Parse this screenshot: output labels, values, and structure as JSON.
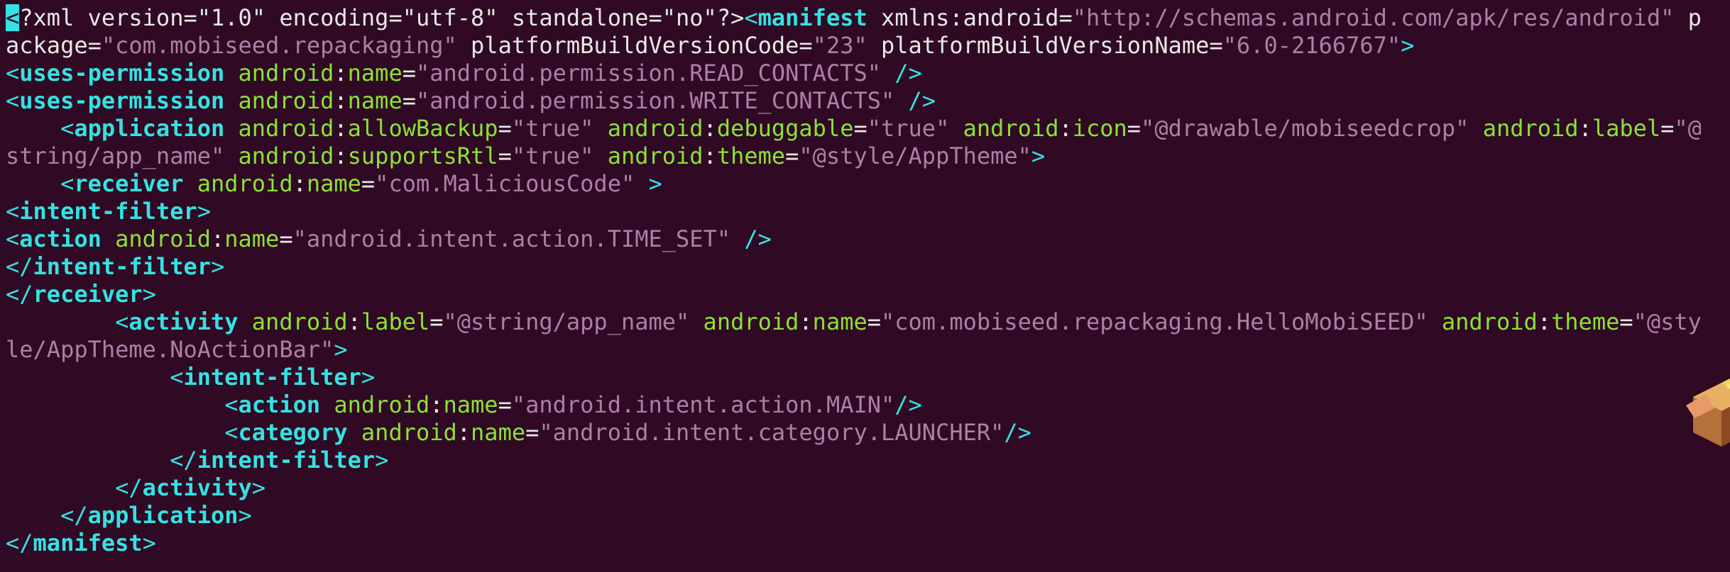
{
  "terminal": {
    "lines": [
      [
        {
          "t": "<",
          "c": "cursor"
        },
        {
          "t": "?xml version=\"1.0\" encoding=\"utf-8\" standalone=\"no\"?>",
          "c": "plain"
        },
        {
          "t": "<",
          "c": "tag"
        },
        {
          "t": "manifest",
          "c": "tagb"
        },
        {
          "t": " xmlns:android",
          "c": "plain"
        },
        {
          "t": "=",
          "c": "eq"
        },
        {
          "t": "\"http://schemas.android.com/apk/res/android\"",
          "c": "str"
        },
        {
          "t": " p",
          "c": "plain"
        }
      ],
      [
        {
          "t": "ackage",
          "c": "plain"
        },
        {
          "t": "=",
          "c": "eq"
        },
        {
          "t": "\"com.mobiseed.repackaging\"",
          "c": "str"
        },
        {
          "t": " platformBuildVersionCode",
          "c": "plain"
        },
        {
          "t": "=",
          "c": "eq"
        },
        {
          "t": "\"23\"",
          "c": "str"
        },
        {
          "t": " platformBuildVersionName",
          "c": "plain"
        },
        {
          "t": "=",
          "c": "eq"
        },
        {
          "t": "\"6.0-2166767\"",
          "c": "str"
        },
        {
          "t": ">",
          "c": "tag"
        }
      ],
      [
        {
          "t": "<",
          "c": "tag"
        },
        {
          "t": "uses-permission",
          "c": "tagb"
        },
        {
          "t": " android",
          "c": "attr"
        },
        {
          "t": ":",
          "c": "plain"
        },
        {
          "t": "name",
          "c": "attr"
        },
        {
          "t": "=",
          "c": "eq"
        },
        {
          "t": "\"android.permission.READ_CONTACTS\"",
          "c": "str"
        },
        {
          "t": " />",
          "c": "tag"
        }
      ],
      [
        {
          "t": "<",
          "c": "tag"
        },
        {
          "t": "uses-permission",
          "c": "tagb"
        },
        {
          "t": " android",
          "c": "attr"
        },
        {
          "t": ":",
          "c": "plain"
        },
        {
          "t": "name",
          "c": "attr"
        },
        {
          "t": "=",
          "c": "eq"
        },
        {
          "t": "\"android.permission.WRITE_CONTACTS\"",
          "c": "str"
        },
        {
          "t": " />",
          "c": "tag"
        }
      ],
      [
        {
          "t": "    <",
          "c": "tag"
        },
        {
          "t": "application",
          "c": "tagb"
        },
        {
          "t": " android",
          "c": "attr"
        },
        {
          "t": ":",
          "c": "plain"
        },
        {
          "t": "allowBackup",
          "c": "attr"
        },
        {
          "t": "=",
          "c": "eq"
        },
        {
          "t": "\"true\"",
          "c": "str"
        },
        {
          "t": " android",
          "c": "attr"
        },
        {
          "t": ":",
          "c": "plain"
        },
        {
          "t": "debuggable",
          "c": "attr"
        },
        {
          "t": "=",
          "c": "eq"
        },
        {
          "t": "\"true\"",
          "c": "str"
        },
        {
          "t": " android",
          "c": "attr"
        },
        {
          "t": ":",
          "c": "plain"
        },
        {
          "t": "icon",
          "c": "attr"
        },
        {
          "t": "=",
          "c": "eq"
        },
        {
          "t": "\"@drawable/mobiseedcrop\"",
          "c": "str"
        },
        {
          "t": " android",
          "c": "attr"
        },
        {
          "t": ":",
          "c": "plain"
        },
        {
          "t": "label",
          "c": "attr"
        },
        {
          "t": "=",
          "c": "eq"
        },
        {
          "t": "\"@",
          "c": "str"
        }
      ],
      [
        {
          "t": "string/app_name\"",
          "c": "str"
        },
        {
          "t": " android",
          "c": "attr"
        },
        {
          "t": ":",
          "c": "plain"
        },
        {
          "t": "supportsRtl",
          "c": "attr"
        },
        {
          "t": "=",
          "c": "eq"
        },
        {
          "t": "\"true\"",
          "c": "str"
        },
        {
          "t": " android",
          "c": "attr"
        },
        {
          "t": ":",
          "c": "plain"
        },
        {
          "t": "theme",
          "c": "attr"
        },
        {
          "t": "=",
          "c": "eq"
        },
        {
          "t": "\"@style/AppTheme\"",
          "c": "str"
        },
        {
          "t": ">",
          "c": "tag"
        }
      ],
      [
        {
          "t": "    <",
          "c": "tag"
        },
        {
          "t": "receiver",
          "c": "tagb"
        },
        {
          "t": " android",
          "c": "attr"
        },
        {
          "t": ":",
          "c": "plain"
        },
        {
          "t": "name",
          "c": "attr"
        },
        {
          "t": "=",
          "c": "eq"
        },
        {
          "t": "\"com.MaliciousCode\"",
          "c": "str"
        },
        {
          "t": " >",
          "c": "tag"
        }
      ],
      [
        {
          "t": "<",
          "c": "tag"
        },
        {
          "t": "intent-filter",
          "c": "tagb"
        },
        {
          "t": ">",
          "c": "tag"
        }
      ],
      [
        {
          "t": "<",
          "c": "tag"
        },
        {
          "t": "action",
          "c": "tagb"
        },
        {
          "t": " android",
          "c": "attr"
        },
        {
          "t": ":",
          "c": "plain"
        },
        {
          "t": "name",
          "c": "attr"
        },
        {
          "t": "=",
          "c": "eq"
        },
        {
          "t": "\"android.intent.action.TIME_SET\"",
          "c": "str"
        },
        {
          "t": " />",
          "c": "tag"
        }
      ],
      [
        {
          "t": "</",
          "c": "tag"
        },
        {
          "t": "intent-filter",
          "c": "tagb"
        },
        {
          "t": ">",
          "c": "tag"
        }
      ],
      [
        {
          "t": "</",
          "c": "tag"
        },
        {
          "t": "receiver",
          "c": "tagb"
        },
        {
          "t": ">",
          "c": "tag"
        }
      ],
      [
        {
          "t": "        <",
          "c": "tag"
        },
        {
          "t": "activity",
          "c": "tagb"
        },
        {
          "t": " android",
          "c": "attr"
        },
        {
          "t": ":",
          "c": "plain"
        },
        {
          "t": "label",
          "c": "attr"
        },
        {
          "t": "=",
          "c": "eq"
        },
        {
          "t": "\"@string/app_name\"",
          "c": "str"
        },
        {
          "t": " android",
          "c": "attr"
        },
        {
          "t": ":",
          "c": "plain"
        },
        {
          "t": "name",
          "c": "attr"
        },
        {
          "t": "=",
          "c": "eq"
        },
        {
          "t": "\"com.mobiseed.repackaging.HelloMobiSEED\"",
          "c": "str"
        },
        {
          "t": " android",
          "c": "attr"
        },
        {
          "t": ":",
          "c": "plain"
        },
        {
          "t": "theme",
          "c": "attr"
        },
        {
          "t": "=",
          "c": "eq"
        },
        {
          "t": "\"@sty",
          "c": "str"
        }
      ],
      [
        {
          "t": "le/AppTheme.NoActionBar\"",
          "c": "str"
        },
        {
          "t": ">",
          "c": "tag"
        }
      ],
      [
        {
          "t": "            <",
          "c": "tag"
        },
        {
          "t": "intent-filter",
          "c": "tagb"
        },
        {
          "t": ">",
          "c": "tag"
        }
      ],
      [
        {
          "t": "                <",
          "c": "tag"
        },
        {
          "t": "action",
          "c": "tagb"
        },
        {
          "t": " android",
          "c": "attr"
        },
        {
          "t": ":",
          "c": "plain"
        },
        {
          "t": "name",
          "c": "attr"
        },
        {
          "t": "=",
          "c": "eq"
        },
        {
          "t": "\"android.intent.action.MAIN\"",
          "c": "str"
        },
        {
          "t": "/>",
          "c": "tag"
        }
      ],
      [
        {
          "t": "                <",
          "c": "tag"
        },
        {
          "t": "category",
          "c": "tagb"
        },
        {
          "t": " android",
          "c": "attr"
        },
        {
          "t": ":",
          "c": "plain"
        },
        {
          "t": "name",
          "c": "attr"
        },
        {
          "t": "=",
          "c": "eq"
        },
        {
          "t": "\"android.intent.category.LAUNCHER\"",
          "c": "str"
        },
        {
          "t": "/>",
          "c": "tag"
        }
      ],
      [
        {
          "t": "            </",
          "c": "tag"
        },
        {
          "t": "intent-filter",
          "c": "tagb"
        },
        {
          "t": ">",
          "c": "tag"
        }
      ],
      [
        {
          "t": "        </",
          "c": "tag"
        },
        {
          "t": "activity",
          "c": "tagb"
        },
        {
          "t": ">",
          "c": "tag"
        }
      ],
      [
        {
          "t": "    </",
          "c": "tag"
        },
        {
          "t": "application",
          "c": "tagb"
        },
        {
          "t": ">",
          "c": "tag"
        }
      ],
      [
        {
          "t": "</",
          "c": "tag"
        },
        {
          "t": "manifest",
          "c": "tagb"
        },
        {
          "t": ">",
          "c": "tag"
        }
      ]
    ]
  },
  "colors": {
    "background": "#300a24",
    "tag": "#34e2e2",
    "attribute": "#8ae234",
    "string": "#ad7fa8",
    "text": "#e8e8e8"
  },
  "desktop": {
    "icon": "package-icon"
  }
}
